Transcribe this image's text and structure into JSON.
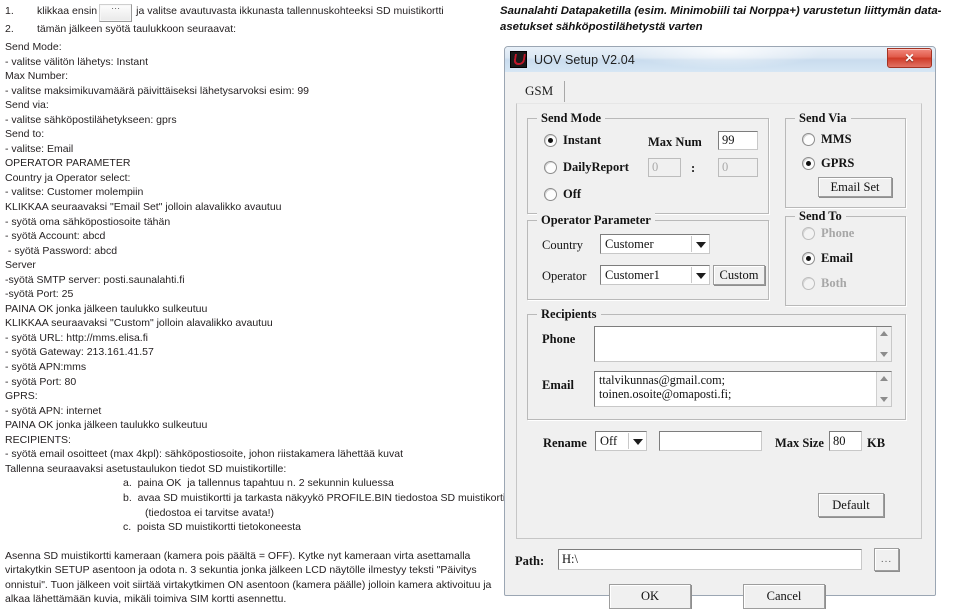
{
  "left_instructions": {
    "step1": {
      "num": "1.",
      "before_button": "klikkaa ensin",
      "button_icon": "ellipsis-button",
      "after_button": "ja valitse avautuvasta ikkunasta tallennuskohteeksi SD muistikortti"
    },
    "step2": {
      "num": "2.",
      "text": "tämän jälkeen syötä taulukkoon seuraavat:"
    },
    "lines": [
      "Send Mode:",
      "- valitse välitön lähetys: Instant",
      "Max Number:",
      "- valitse maksimikuvamäärä päivittäiseksi lähetysarvoksi esim: 99",
      "Send via:",
      "- valitse sähköpostilähetykseen: gprs",
      "Send to:",
      "- valitse: Email",
      "OPERATOR PARAMETER",
      "Country ja Operator select:",
      "- valitse: Customer molempiin",
      "KLIKKAA seuraavaksi \"Email Set\" jolloin alavalikko avautuu",
      "- syötä oma sähköpostiosoite tähän",
      "- syötä Account: abcd",
      " - syötä Password: abcd",
      "Server",
      "-syötä SMTP server: posti.saunalahti.fi",
      "-syötä Port: 25",
      "PAINA OK jonka jälkeen taulukko sulkeutuu",
      "KLIKKAA seuraavaksi \"Custom\" jolloin alavalikko avautuu",
      "- syötä URL: http://mms.elisa.fi",
      "- syötä Gateway: 213.161.41.57",
      "- syötä APN:mms",
      "- syötä Port: 80",
      "GPRS:",
      "- syötä APN: internet",
      "PAINA OK jonka jälkeen taulukko sulkeutuu",
      "RECIPIENTS:",
      "- syötä email osoitteet (max 4kpl): sähköpostiosoite, johon riistakamera lähettää kuvat",
      "Tallenna seuraavaksi asetustaulukon tiedot SD muistikortille:"
    ],
    "sub_items": [
      "a.  paina OK  ja tallennus tapahtuu n. 2 sekunnin kuluessa",
      "b.  avaa SD muistikortti ja tarkasta näkyykö PROFILE.BIN tiedostoa SD muistikortilla",
      "(tiedostoa ei tarvitse avata!)",
      "c.  poista SD muistikortti tietokoneesta"
    ],
    "final_paragraph": "Asenna SD muistikortti kameraan (kamera pois päältä = OFF). Kytke nyt kameraan virta asettamalla virtakytkin SETUP asentoon ja odota n. 3 sekuntia jonka jälkeen LCD näytölle ilmestyy teksti \"Päivitys onnistui\". Tuon jälkeen voit siirtää virtakytkimen ON asentoon (kamera päälle) jolloin kamera aktivoituu ja alkaa lähettämään kuvia, mikäli toimiva SIM kortti asennettu."
  },
  "right_heading": "Saunalahti Datapaketilla (esim. Minimobiili tai Norppa+) varustetun liittymän data-asetukset sähköpostilähetystä varten",
  "dialog": {
    "title": "UOV Setup V2.04",
    "close_label": "✕",
    "tabs": [
      {
        "label": "GSM",
        "active": true
      }
    ],
    "send_mode": {
      "legend": "Send Mode",
      "options": [
        {
          "label": "Instant",
          "checked": true,
          "disabled": false
        },
        {
          "label": "DailyReport",
          "checked": false,
          "disabled": false
        },
        {
          "label": "Off",
          "checked": false,
          "disabled": false
        }
      ],
      "max_num_label": "Max Num",
      "max_num_value": "99",
      "daily_hour": "0",
      "daily_separator": ":",
      "daily_minute": "0"
    },
    "send_via": {
      "legend": "Send Via",
      "options": [
        {
          "label": "MMS",
          "checked": false,
          "disabled": false
        },
        {
          "label": "GPRS",
          "checked": true,
          "disabled": false
        }
      ],
      "email_set_button": "Email Set"
    },
    "send_to": {
      "legend": "Send To",
      "options": [
        {
          "label": "Phone",
          "checked": false,
          "disabled": true
        },
        {
          "label": "Email",
          "checked": true,
          "disabled": false
        },
        {
          "label": "Both",
          "checked": false,
          "disabled": true
        }
      ]
    },
    "operator_parameter": {
      "legend": "Operator Parameter",
      "country_label": "Country",
      "country_value": "Customer",
      "operator_label": "Operator",
      "operator_value": "Customer1",
      "custom_button": "Custom"
    },
    "recipients": {
      "legend": "Recipients",
      "phone_label": "Phone",
      "phone_value": "",
      "email_label": "Email",
      "email_value": "ttalvikunnas@gmail.com;\ntoinen.osoite@omaposti.fi;"
    },
    "rename_row": {
      "rename_label": "Rename",
      "rename_value": "Off",
      "rename_text_value": "",
      "max_size_label": "Max Size",
      "max_size_value": "80",
      "max_size_unit": "KB"
    },
    "default_button": "Default",
    "path_row": {
      "label": "Path:",
      "value": "H:\\",
      "browse_button": "..."
    },
    "ok_button": "OK",
    "cancel_button": "Cancel"
  },
  "colors": {
    "window_face": "#f0f0f0",
    "titlebar": "#d6e6f4",
    "close_red": "#cf3a27",
    "text": "#141414"
  }
}
